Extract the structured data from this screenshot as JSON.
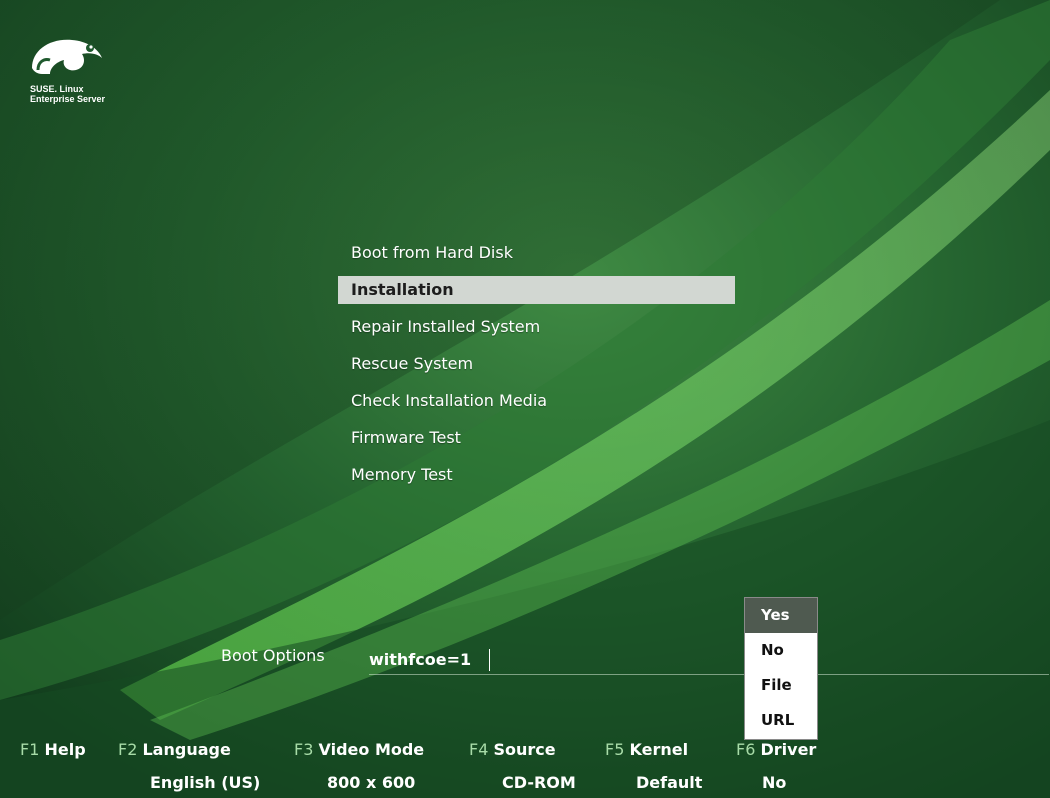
{
  "logo": {
    "line1": "SUSE. Linux",
    "line2": "Enterprise Server",
    "icon": "chameleon-icon"
  },
  "menu": {
    "items": [
      {
        "label": "Boot from Hard Disk"
      },
      {
        "label": "Installation",
        "selected": true
      },
      {
        "label": "Repair Installed System"
      },
      {
        "label": "Rescue System"
      },
      {
        "label": "Check Installation Media"
      },
      {
        "label": "Firmware Test"
      },
      {
        "label": "Memory Test"
      }
    ]
  },
  "boot_options": {
    "label": "Boot Options",
    "value": "withfcoe=1"
  },
  "driver_popup": {
    "options": [
      "Yes",
      "No",
      "File",
      "URL"
    ],
    "active": "Yes"
  },
  "fkeys": [
    {
      "key": "F1",
      "label": "Help",
      "value": ""
    },
    {
      "key": "F2",
      "label": "Language",
      "value": "English (US)"
    },
    {
      "key": "F3",
      "label": "Video Mode",
      "value": "800 x 600"
    },
    {
      "key": "F4",
      "label": "Source",
      "value": "CD-ROM"
    },
    {
      "key": "F5",
      "label": "Kernel",
      "value": "Default"
    },
    {
      "key": "F6",
      "label": "Driver",
      "value": "No"
    }
  ],
  "colors": {
    "background": "#1f5a2e",
    "accent_green": "#a8dca8",
    "selection": "#d2d7d2",
    "popup_active": "#4f5a50"
  }
}
